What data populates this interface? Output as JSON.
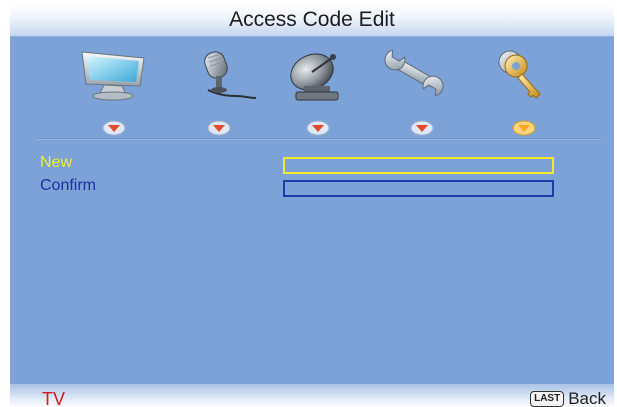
{
  "header": {
    "title": "Access Code Edit"
  },
  "menu_icons": [
    {
      "name": "picture-icon"
    },
    {
      "name": "audio-icon"
    },
    {
      "name": "channel-icon"
    },
    {
      "name": "setup-icon"
    },
    {
      "name": "lock-icon",
      "selected": true
    }
  ],
  "form": {
    "new_label": "New",
    "confirm_label": "Confirm",
    "new_value": "",
    "confirm_value": ""
  },
  "footer": {
    "source": "TV",
    "back_key": "LAST",
    "back_label": "Back"
  },
  "colors": {
    "background": "#7ca2d7",
    "focus_yellow": "#f2ea2a",
    "field_blue": "#1e3ca8",
    "source_red": "#d11a1a",
    "arrow_selected": "#f5a623"
  }
}
